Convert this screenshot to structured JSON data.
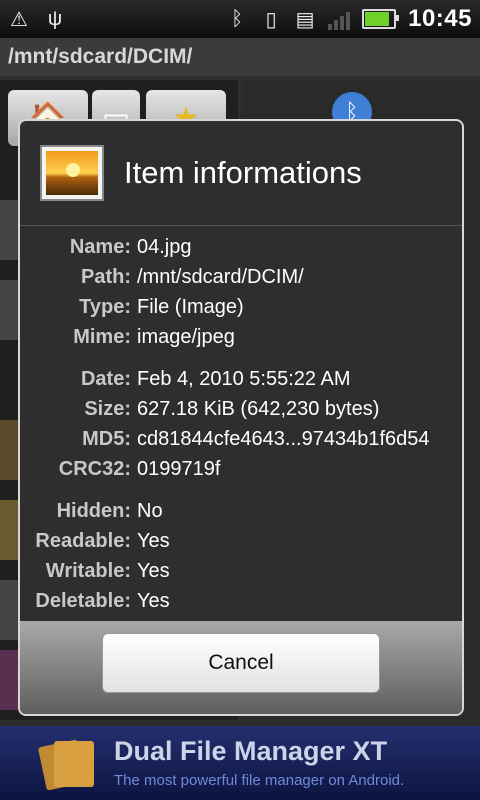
{
  "status_bar": {
    "time": "10:45",
    "icons": [
      "warning-icon",
      "usb-icon",
      "bluetooth-icon",
      "vibrate-icon",
      "sim-card-icon",
      "no-signal-icon",
      "battery-icon"
    ]
  },
  "path_bar": {
    "path": "/mnt/sdcard/DCIM/"
  },
  "dialog": {
    "title": "Item informations",
    "rows": [
      {
        "label": "Name:",
        "value": "04.jpg"
      },
      {
        "label": "Path:",
        "value": "/mnt/sdcard/DCIM/"
      },
      {
        "label": "Type:",
        "value": "File (Image)"
      },
      {
        "label": "Mime:",
        "value": "image/jpeg"
      },
      {
        "label": "Date:",
        "value": "Feb 4, 2010 5:55:22 AM"
      },
      {
        "label": "Size:",
        "value": "627.18 KiB (642,230 bytes)"
      },
      {
        "label": "MD5:",
        "value": "cd81844cfe4643...97434b1f6d54"
      },
      {
        "label": "CRC32:",
        "value": "0199719f"
      },
      {
        "label": "Hidden:",
        "value": "No"
      },
      {
        "label": "Readable:",
        "value": "Yes"
      },
      {
        "label": "Writable:",
        "value": "Yes"
      },
      {
        "label": "Deletable:",
        "value": "Yes"
      }
    ],
    "cancel_label": "Cancel"
  },
  "ad_banner": {
    "title": "Dual File Manager XT",
    "subtitle": "The most powerful file manager on Android."
  }
}
